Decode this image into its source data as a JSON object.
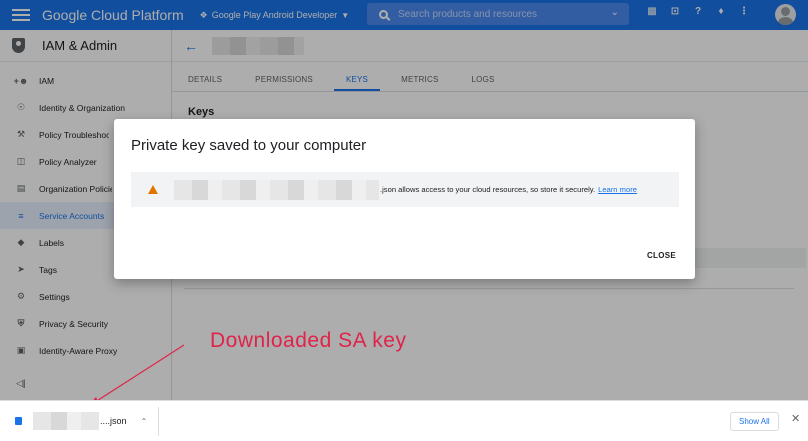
{
  "topbar": {
    "brand": "Google Cloud Platform",
    "project": "Google Play Android Developer",
    "search_placeholder": "Search products and resources"
  },
  "sidebar": {
    "title": "IAM & Admin",
    "items": [
      {
        "label": "IAM",
        "icon": "person-add-icon"
      },
      {
        "label": "Identity & Organization",
        "icon": "account-circle-icon"
      },
      {
        "label": "Policy Troubleshooter",
        "icon": "wrench-icon"
      },
      {
        "label": "Policy Analyzer",
        "icon": "analyzer-icon"
      },
      {
        "label": "Organization Policies",
        "icon": "list-icon"
      },
      {
        "label": "Service Accounts",
        "icon": "service-account-icon",
        "active": true
      },
      {
        "label": "Labels",
        "icon": "label-icon"
      },
      {
        "label": "Tags",
        "icon": "tag-icon"
      },
      {
        "label": "Settings",
        "icon": "gear-icon"
      },
      {
        "label": "Privacy & Security",
        "icon": "shield-icon"
      },
      {
        "label": "Identity-Aware Proxy",
        "icon": "proxy-icon"
      }
    ]
  },
  "tabs": [
    "DETAILS",
    "PERMISSIONS",
    "KEYS",
    "METRICS",
    "LOGS"
  ],
  "active_tab": "KEYS",
  "section_title": "Keys",
  "dialog": {
    "title": "Private key saved to your computer",
    "message": ".json allows access to your cloud resources, so store it securely.",
    "link": "Learn more",
    "close": "CLOSE"
  },
  "annotation": "Downloaded SA key",
  "download_bar": {
    "filename": "....json",
    "show_all": "Show All"
  },
  "colors": {
    "primary": "#1a73e8",
    "warning": "#e37400",
    "annotation": "#e0234a"
  }
}
